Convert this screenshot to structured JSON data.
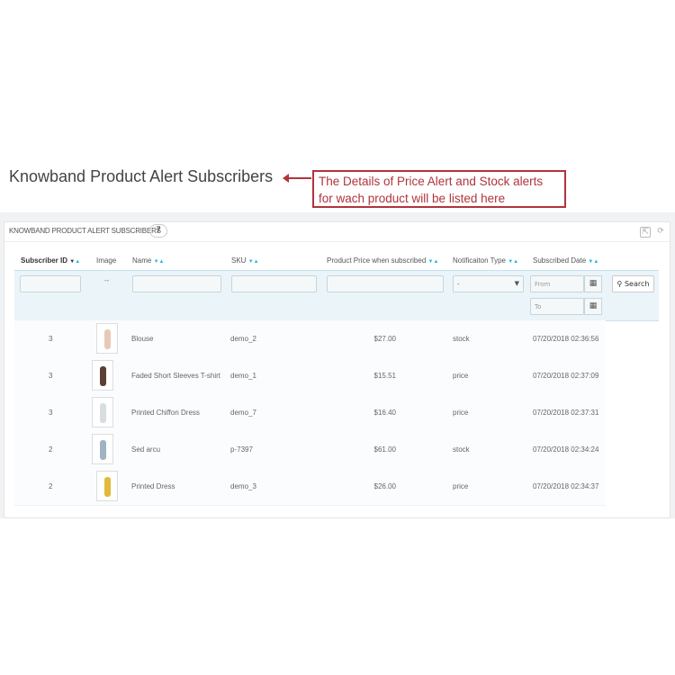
{
  "page_title": "Knowband Product Alert Subscribers",
  "callout": {
    "line1": "The Details of Price Alert and Stock alerts",
    "line2": "for wach product will be listed here"
  },
  "panel": {
    "title": "KNOWBAND PRODUCT ALERT SUBSCRIBERS",
    "count": "7"
  },
  "columns": {
    "id": "Subscriber ID",
    "image": "Image",
    "name": "Name",
    "sku": "SKU",
    "price": "Product Price when subscribed",
    "type": "Notificaiton Type",
    "date": "Subscribed Date"
  },
  "filters": {
    "image": "--",
    "type_value": "-",
    "from_placeholder": "From",
    "to_placeholder": "To",
    "search": "Search"
  },
  "rows": [
    {
      "id": "3",
      "name": "Blouse",
      "sku": "demo_2",
      "price": "$27.00",
      "type": "stock",
      "date": "07/20/2018 02:36:56",
      "color": "#e8c9b8"
    },
    {
      "id": "3",
      "name": "Faded Short Sleeves T-shirt",
      "sku": "demo_1",
      "price": "$15.51",
      "type": "price",
      "date": "07/20/2018 02:37:09",
      "color": "#5a4036"
    },
    {
      "id": "3",
      "name": "Printed Chiffon Dress",
      "sku": "demo_7",
      "price": "$16.40",
      "type": "price",
      "date": "07/20/2018 02:37:31",
      "color": "#d8dde0"
    },
    {
      "id": "2",
      "name": "Sed arcu",
      "sku": "p-7397",
      "price": "$61.00",
      "type": "stock",
      "date": "07/20/2018 02:34:24",
      "color": "#9fb3c4"
    },
    {
      "id": "2",
      "name": "Printed Dress",
      "sku": "demo_3",
      "price": "$26.00",
      "type": "price",
      "date": "07/20/2018 02:34:37",
      "color": "#e2b93a"
    }
  ]
}
